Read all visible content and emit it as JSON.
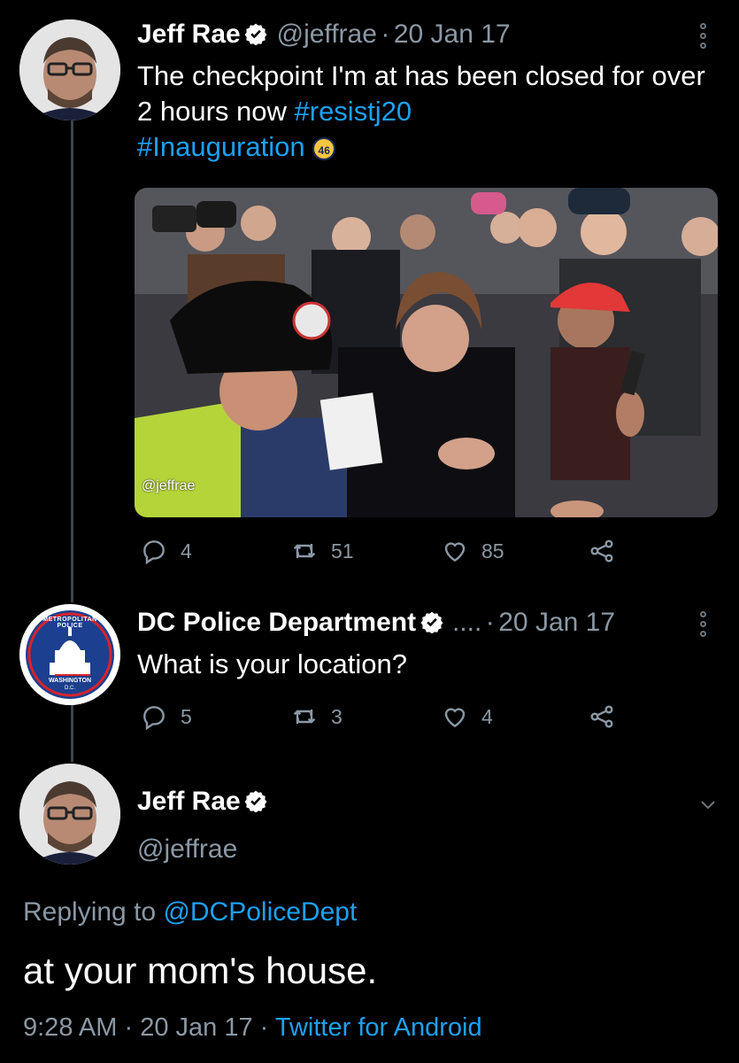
{
  "tweet1": {
    "name": "Jeff Rae",
    "handle": "@jeffrae",
    "dot": "·",
    "date": "20 Jan 17",
    "text_plain": "The checkpoint I'm at has been closed for over 2 hours now ",
    "hashtag1": "#resistj20",
    "hashtag2": "#Inauguration",
    "badge_text": "46",
    "photo_watermark": "@jeffrae",
    "counts": {
      "replies": "4",
      "retweets": "51",
      "likes": "85"
    }
  },
  "tweet2": {
    "name": "DC Police Department",
    "handle": "....",
    "dot": "·",
    "date": "20 Jan 17",
    "text": "What is your location?",
    "counts": {
      "replies": "5",
      "retweets": "3",
      "likes": "4"
    },
    "logo_text_top": "METROPOLITAN POLICE",
    "logo_text_bottom": "WASHINGTON",
    "logo_text_dc": "D.C."
  },
  "tweet3": {
    "name": "Jeff Rae",
    "handle": "@jeffrae",
    "replying_label": "Replying to ",
    "replying_to": "@DCPoliceDept",
    "text": "at your mom's house.",
    "time": "9:28 AM",
    "dot1": "·",
    "date": "20 Jan 17",
    "dot2": "·",
    "source": "Twitter for Android"
  },
  "colors": {
    "background": "#000000",
    "link": "#1da1f2",
    "secondary": "#8b98a5",
    "verified": "#ffffff"
  }
}
